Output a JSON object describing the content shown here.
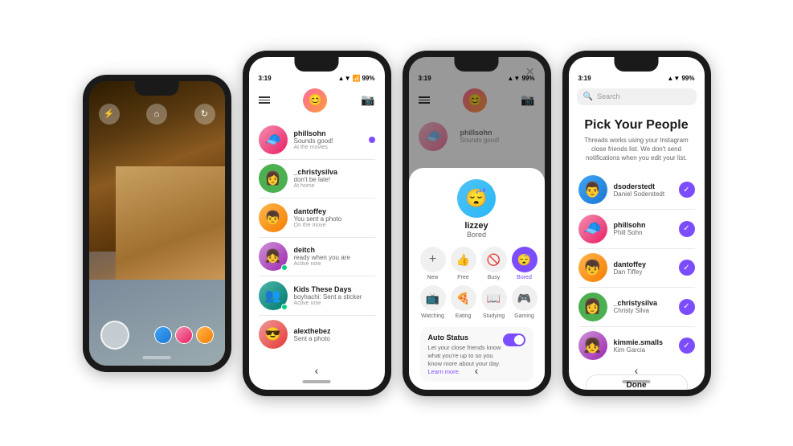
{
  "phones": [
    {
      "id": "camera",
      "statusTime": "",
      "type": "camera"
    },
    {
      "id": "messages",
      "statusTime": "3:19",
      "statusIcons": "▲▼ 99%",
      "type": "messages",
      "header": {
        "title": ""
      },
      "messages": [
        {
          "user": "phillsohn",
          "preview": "Sounds good!",
          "meta": "At the movies",
          "hasUnread": true,
          "avatarColor": "av-pink"
        },
        {
          "user": "_christysilva",
          "preview": "don't be late!",
          "meta": "At home",
          "hasUnread": false,
          "avatarColor": "av-green"
        },
        {
          "user": "dantoffey",
          "preview": "You sent a photo",
          "meta": "On the move",
          "hasUnread": false,
          "avatarColor": "av-orange"
        },
        {
          "user": "deitch",
          "preview": "ready when you are",
          "meta": "Active now",
          "hasUnread": false,
          "avatarColor": "av-purple"
        },
        {
          "user": "Kids These Days",
          "preview": "boyhachi: Sent a sticker",
          "meta": "Active now",
          "hasUnread": false,
          "avatarColor": "av-teal"
        },
        {
          "user": "alexthebez",
          "preview": "Sent a photo",
          "meta": "",
          "hasUnread": false,
          "avatarColor": "av-red"
        }
      ]
    },
    {
      "id": "status",
      "statusTime": "3:19",
      "statusIcons": "▲▼ 99%",
      "type": "status",
      "modal": {
        "username": "lizzey",
        "statusText": "Bored",
        "statusItems": [
          {
            "emoji": "+",
            "label": "New",
            "selected": false,
            "isPlus": true
          },
          {
            "emoji": "👍",
            "label": "Free",
            "selected": false
          },
          {
            "emoji": "🚫",
            "label": "Busy",
            "selected": false
          },
          {
            "emoji": "😴",
            "label": "Bored",
            "selected": true
          },
          {
            "emoji": "📺",
            "label": "Watching",
            "selected": false
          },
          {
            "emoji": "🍕",
            "label": "Eating",
            "selected": false
          },
          {
            "emoji": "📖",
            "label": "Studying",
            "selected": false
          },
          {
            "emoji": "🎮",
            "label": "Gaming",
            "selected": false
          }
        ],
        "autoStatus": {
          "title": "Auto Status",
          "description": "Let your close friends know what you're up to so you know more about your day.",
          "learnMore": "Learn more."
        }
      }
    },
    {
      "id": "pick-people",
      "statusTime": "3:19",
      "statusIcons": "▲▼ 99%",
      "type": "pick-people",
      "search": {
        "placeholder": "Search"
      },
      "title": "Pick Your People",
      "subtitle": "Threads works using your Instagram close friends list. We don't send notifications when you edit your list.",
      "people": [
        {
          "username": "dsoderstedt",
          "fullName": "Daniel Soderstedt",
          "avatarColor": "av-blue",
          "checked": true
        },
        {
          "username": "phillsohn",
          "fullName": "Phill Sohn",
          "avatarColor": "av-pink",
          "checked": true
        },
        {
          "username": "dantoffey",
          "fullName": "Dan Tiffey",
          "avatarColor": "av-orange",
          "checked": true
        },
        {
          "username": "_christysilva",
          "fullName": "Christy Silva",
          "avatarColor": "av-green",
          "checked": true
        },
        {
          "username": "kimmie.smalls",
          "fullName": "Kim Garcia",
          "avatarColor": "av-purple",
          "checked": true
        }
      ],
      "doneLabel": "Done"
    }
  ]
}
